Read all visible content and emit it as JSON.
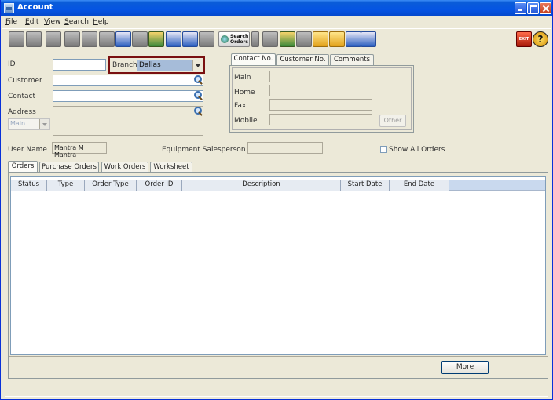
{
  "window": {
    "title": "Account"
  },
  "menu": [
    {
      "mnemonic": "F",
      "rest": "ile"
    },
    {
      "mnemonic": "E",
      "rest": "dit"
    },
    {
      "mnemonic": "V",
      "rest": "iew"
    },
    {
      "mnemonic": "S",
      "rest": "earch"
    },
    {
      "mnemonic": "H",
      "rest": "elp"
    }
  ],
  "toolbar": {
    "search_orders_line1": "Search",
    "search_orders_line2": "Orders",
    "exit_label": "EXIT",
    "help_label": "?"
  },
  "form": {
    "id_label": "ID",
    "id_value": "",
    "branch_label": "Branch",
    "branch_value": "Dallas",
    "customer_label": "Customer",
    "customer_value": "",
    "contact_label": "Contact",
    "contact_value": "",
    "address_label": "Address",
    "address_type": "Main",
    "user_name_label": "User Name",
    "user_name_value": "Mantra M Mantra",
    "equipment_salesperson_label": "Equipment Salesperson",
    "equipment_salesperson_value": "",
    "show_all_orders_label": "Show All Orders",
    "show_all_orders_checked": false
  },
  "contact_tabs": [
    "Contact No.",
    "Customer No.",
    "Comments"
  ],
  "contact_panel": {
    "main_label": "Main",
    "home_label": "Home",
    "fax_label": "Fax",
    "mobile_label": "Mobile",
    "other_button": "Other"
  },
  "order_tabs": [
    "Orders",
    "Purchase Orders",
    "Work Orders",
    "Worksheet"
  ],
  "orders_table": {
    "columns": [
      "Status",
      "Type",
      "Order Type",
      "Order ID",
      "Description",
      "Start Date",
      "End Date"
    ],
    "rows": []
  },
  "buttons": {
    "more": "More"
  }
}
